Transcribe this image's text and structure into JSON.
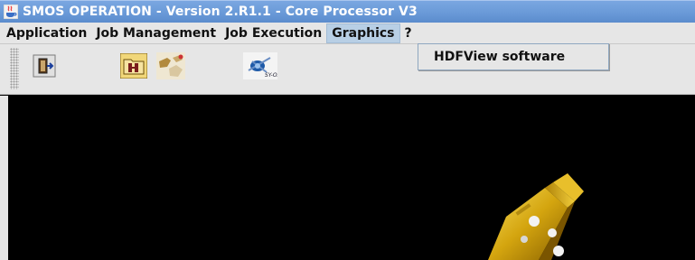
{
  "window": {
    "title": "SMOS  OPERATION - Version 2.R1.1 - Core Processor V3",
    "app_icon": "java-coffee-cup-icon"
  },
  "menubar": {
    "items": [
      {
        "label": "Application"
      },
      {
        "label": "Job Management"
      },
      {
        "label": "Job Execution"
      },
      {
        "label": "Graphics"
      },
      {
        "label": "?"
      }
    ],
    "active": "Graphics"
  },
  "toolbar": {
    "buttons": [
      {
        "icon": "exit-door-icon"
      },
      {
        "icon": "open-folder-icon"
      },
      {
        "icon": "puzzle-pieces-icon"
      },
      {
        "icon": "smos-satellite-logo-icon"
      }
    ]
  },
  "dropdown": {
    "items": [
      {
        "label": "HDFView software"
      }
    ]
  },
  "canvas": {
    "background": "#000000",
    "illustration": "gold-satellite-icon"
  },
  "colors": {
    "titlebar": "#6a9ad8",
    "menu_active": "#b8cfe5",
    "panel": "#e6e6e6",
    "gold": "#d4a50f"
  }
}
